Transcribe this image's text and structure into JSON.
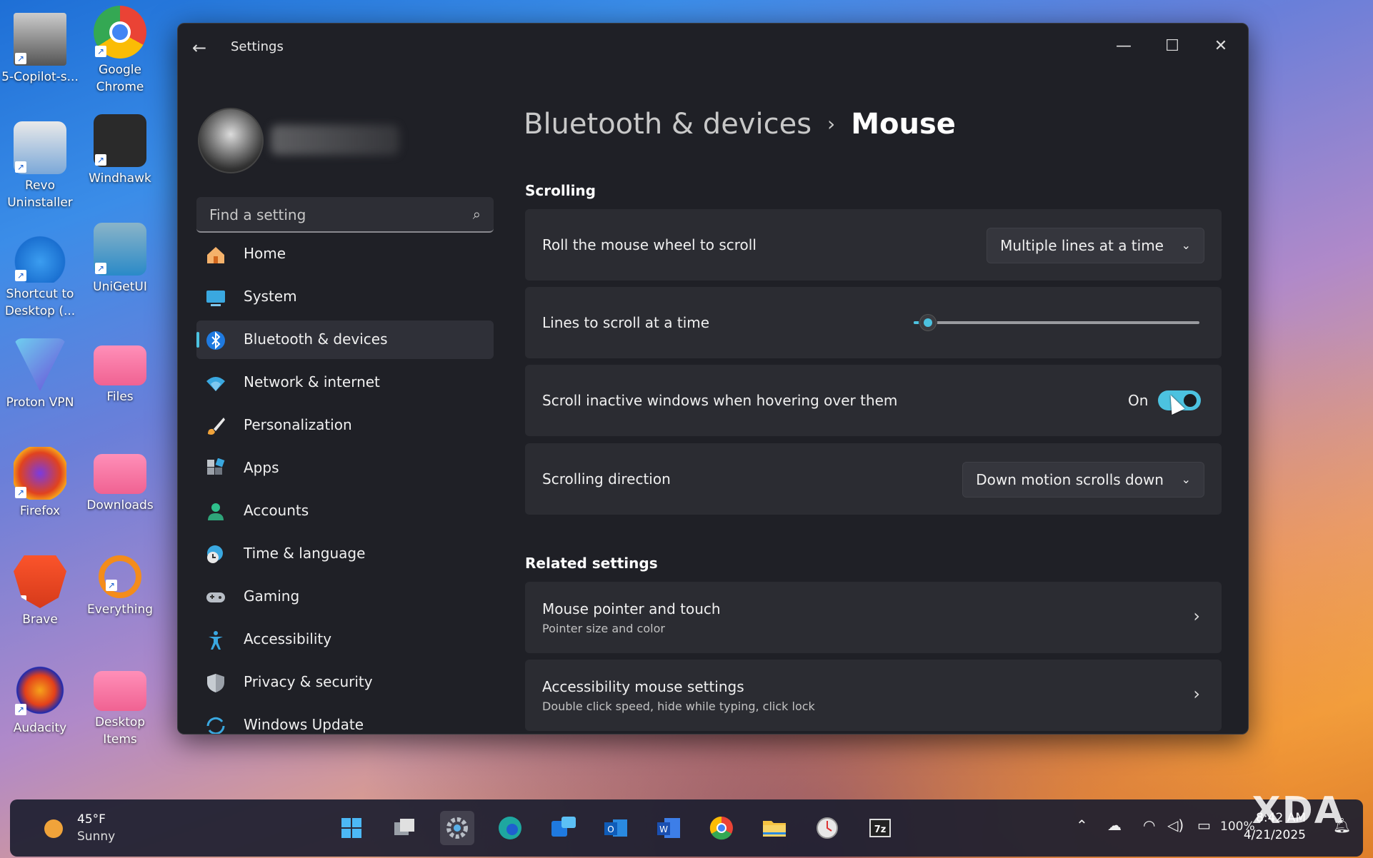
{
  "desktop": {
    "icons": [
      {
        "label": "5-Copilot-s..."
      },
      {
        "label": "Google Chrome"
      },
      {
        "label": "Revo Uninstaller"
      },
      {
        "label": "Windhawk"
      },
      {
        "label": "Shortcut to Desktop (..."
      },
      {
        "label": "UniGetUI"
      },
      {
        "label": "Proton VPN"
      },
      {
        "label": "Files"
      },
      {
        "label": "Firefox"
      },
      {
        "label": "Downloads"
      },
      {
        "label": "Brave"
      },
      {
        "label": "Everything"
      },
      {
        "label": "Audacity"
      },
      {
        "label": "Desktop Items"
      }
    ]
  },
  "window": {
    "title": "Settings",
    "back_icon": "arrow-left-icon",
    "controls": [
      "minimize-icon",
      "maximize-icon",
      "close-icon"
    ]
  },
  "sidebar": {
    "search_placeholder": "Find a setting",
    "items": [
      {
        "label": "Home",
        "icon": "home-icon"
      },
      {
        "label": "System",
        "icon": "monitor-icon"
      },
      {
        "label": "Bluetooth & devices",
        "icon": "bluetooth-icon",
        "active": true
      },
      {
        "label": "Network & internet",
        "icon": "wifi-icon"
      },
      {
        "label": "Personalization",
        "icon": "brush-icon"
      },
      {
        "label": "Apps",
        "icon": "apps-icon"
      },
      {
        "label": "Accounts",
        "icon": "person-icon"
      },
      {
        "label": "Time & language",
        "icon": "clock-globe-icon"
      },
      {
        "label": "Gaming",
        "icon": "gamepad-icon"
      },
      {
        "label": "Accessibility",
        "icon": "accessibility-icon"
      },
      {
        "label": "Privacy & security",
        "icon": "shield-icon"
      },
      {
        "label": "Windows Update",
        "icon": "update-icon"
      }
    ]
  },
  "main": {
    "breadcrumb": {
      "parent": "Bluetooth & devices",
      "separator": "›",
      "current": "Mouse"
    },
    "scrolling": {
      "heading": "Scrolling",
      "wheel": {
        "label": "Roll the mouse wheel to scroll",
        "value": "Multiple lines at a time"
      },
      "lines": {
        "label": "Lines to scroll at a time",
        "level": 0.05
      },
      "inactive": {
        "label": "Scroll inactive windows when hovering over them",
        "state": "On"
      },
      "direction": {
        "label": "Scrolling direction",
        "value": "Down motion scrolls down"
      }
    },
    "related": {
      "heading": "Related settings",
      "items": [
        {
          "title": "Mouse pointer and touch",
          "subtitle": "Pointer size and color"
        },
        {
          "title": "Accessibility mouse settings",
          "subtitle": "Double click speed, hide while typing, click lock"
        }
      ]
    }
  },
  "taskbar": {
    "weather_temp": "45°F",
    "weather_desc": "Sunny",
    "battery": "100%",
    "time": "8:42 AM",
    "date": "4/21/2025",
    "watermark": "XDA"
  },
  "colors": {
    "accent": "#4cc2e0",
    "window_bg": "#1f2026",
    "card_bg": "#2b2c32"
  }
}
